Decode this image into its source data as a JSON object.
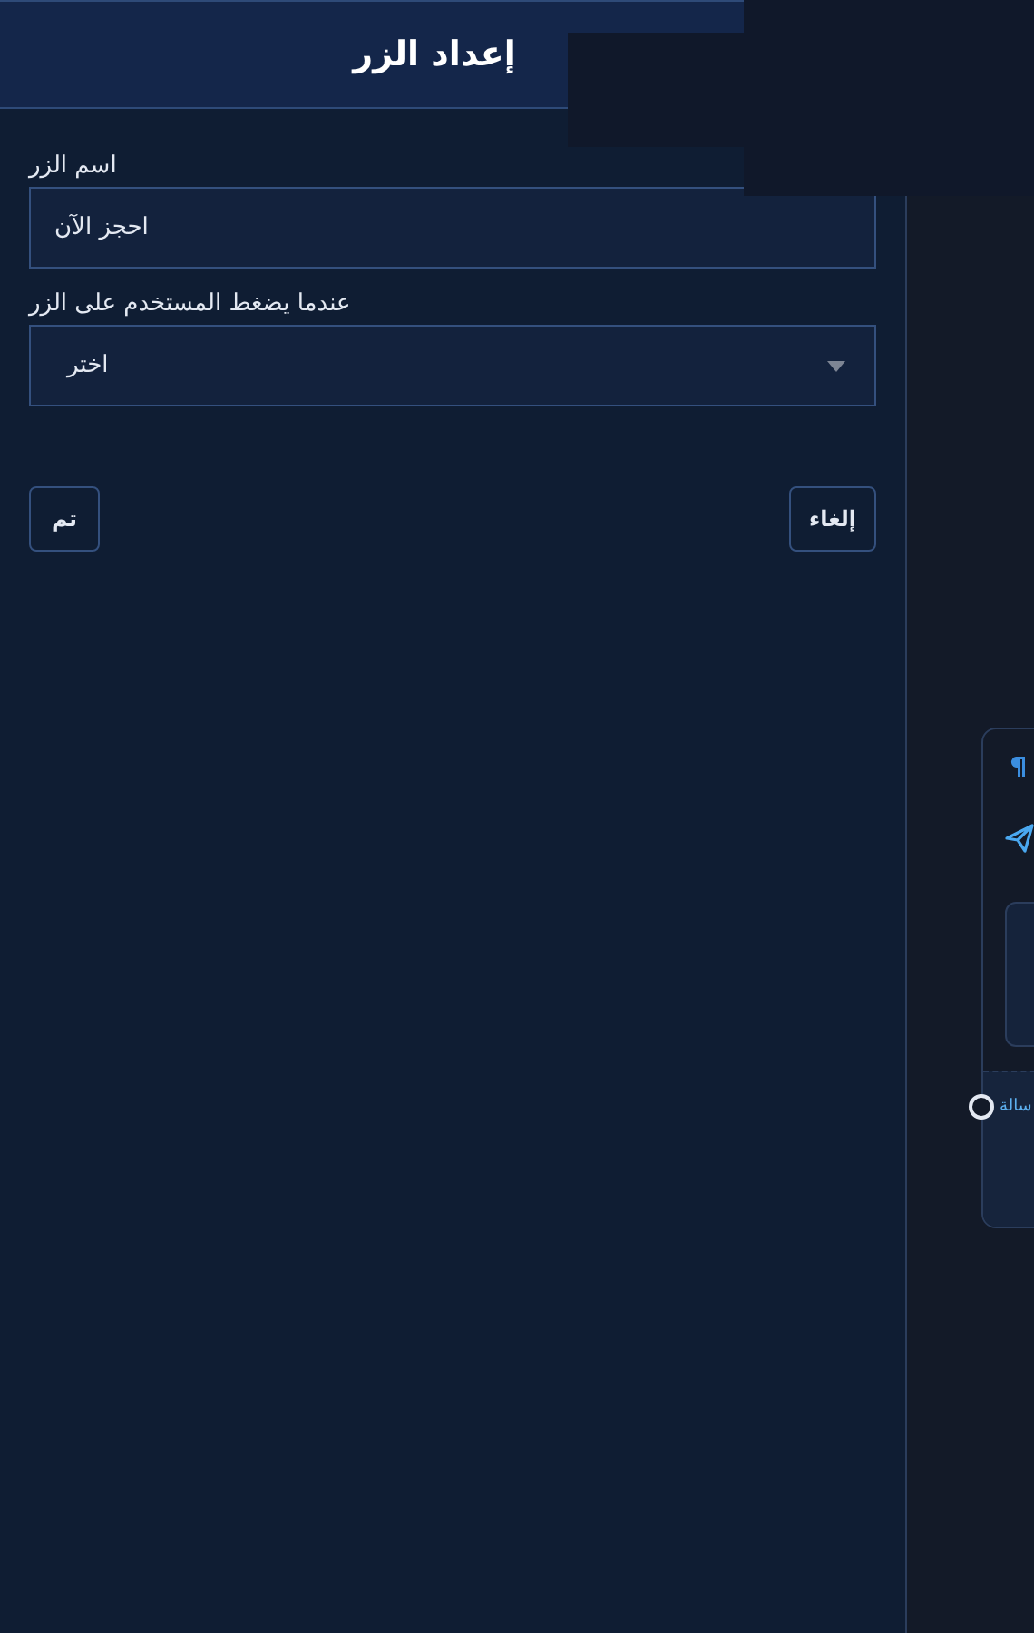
{
  "dialog": {
    "title": "إعداد الزر",
    "fields": [
      {
        "kind": "text",
        "label": "اسم الزر",
        "value": "احجز الآن"
      },
      {
        "kind": "select",
        "label": "عندما يضغط المستخدم على الزر",
        "value": "اختر"
      }
    ],
    "buttons": [
      {
        "label": "إلغاء"
      },
      {
        "label": "تم"
      }
    ]
  },
  "node_card": {
    "port_label": "سالة"
  }
}
